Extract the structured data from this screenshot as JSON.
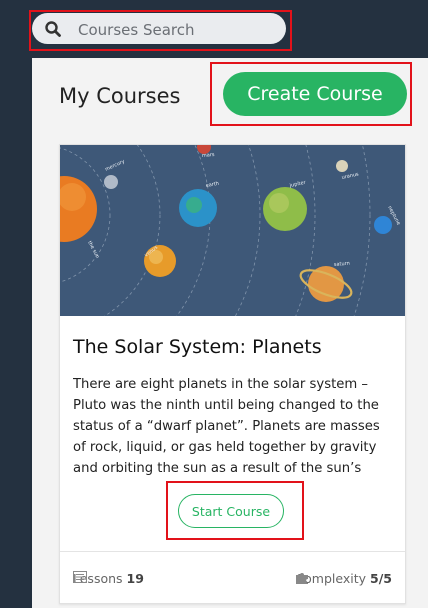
{
  "search": {
    "placeholder": "Courses Search"
  },
  "page": {
    "title": "My Courses",
    "create_button_label": "Create Course"
  },
  "course": {
    "title": "The Solar System: Planets",
    "description": "There are eight planets in the solar system – Pluto was the ninth until being changed to the status of a “dwarf planet”. Planets are masses of rock, liquid, or gas held together by gravity and orbiting the sun as a result of the sun’s",
    "start_button_label": "Start Course",
    "lessons_label": "Lessons",
    "lessons_count": "19",
    "complexity_label": "Complexity",
    "complexity_value": "5/5",
    "image_labels": [
      "the sun",
      "mercury",
      "venus",
      "earth",
      "mars",
      "jupiter",
      "saturn",
      "uranus",
      "neptune"
    ]
  },
  "colors": {
    "accent": "#28b463",
    "topbar": "#243140",
    "illustration_bg": "#3e5878"
  }
}
